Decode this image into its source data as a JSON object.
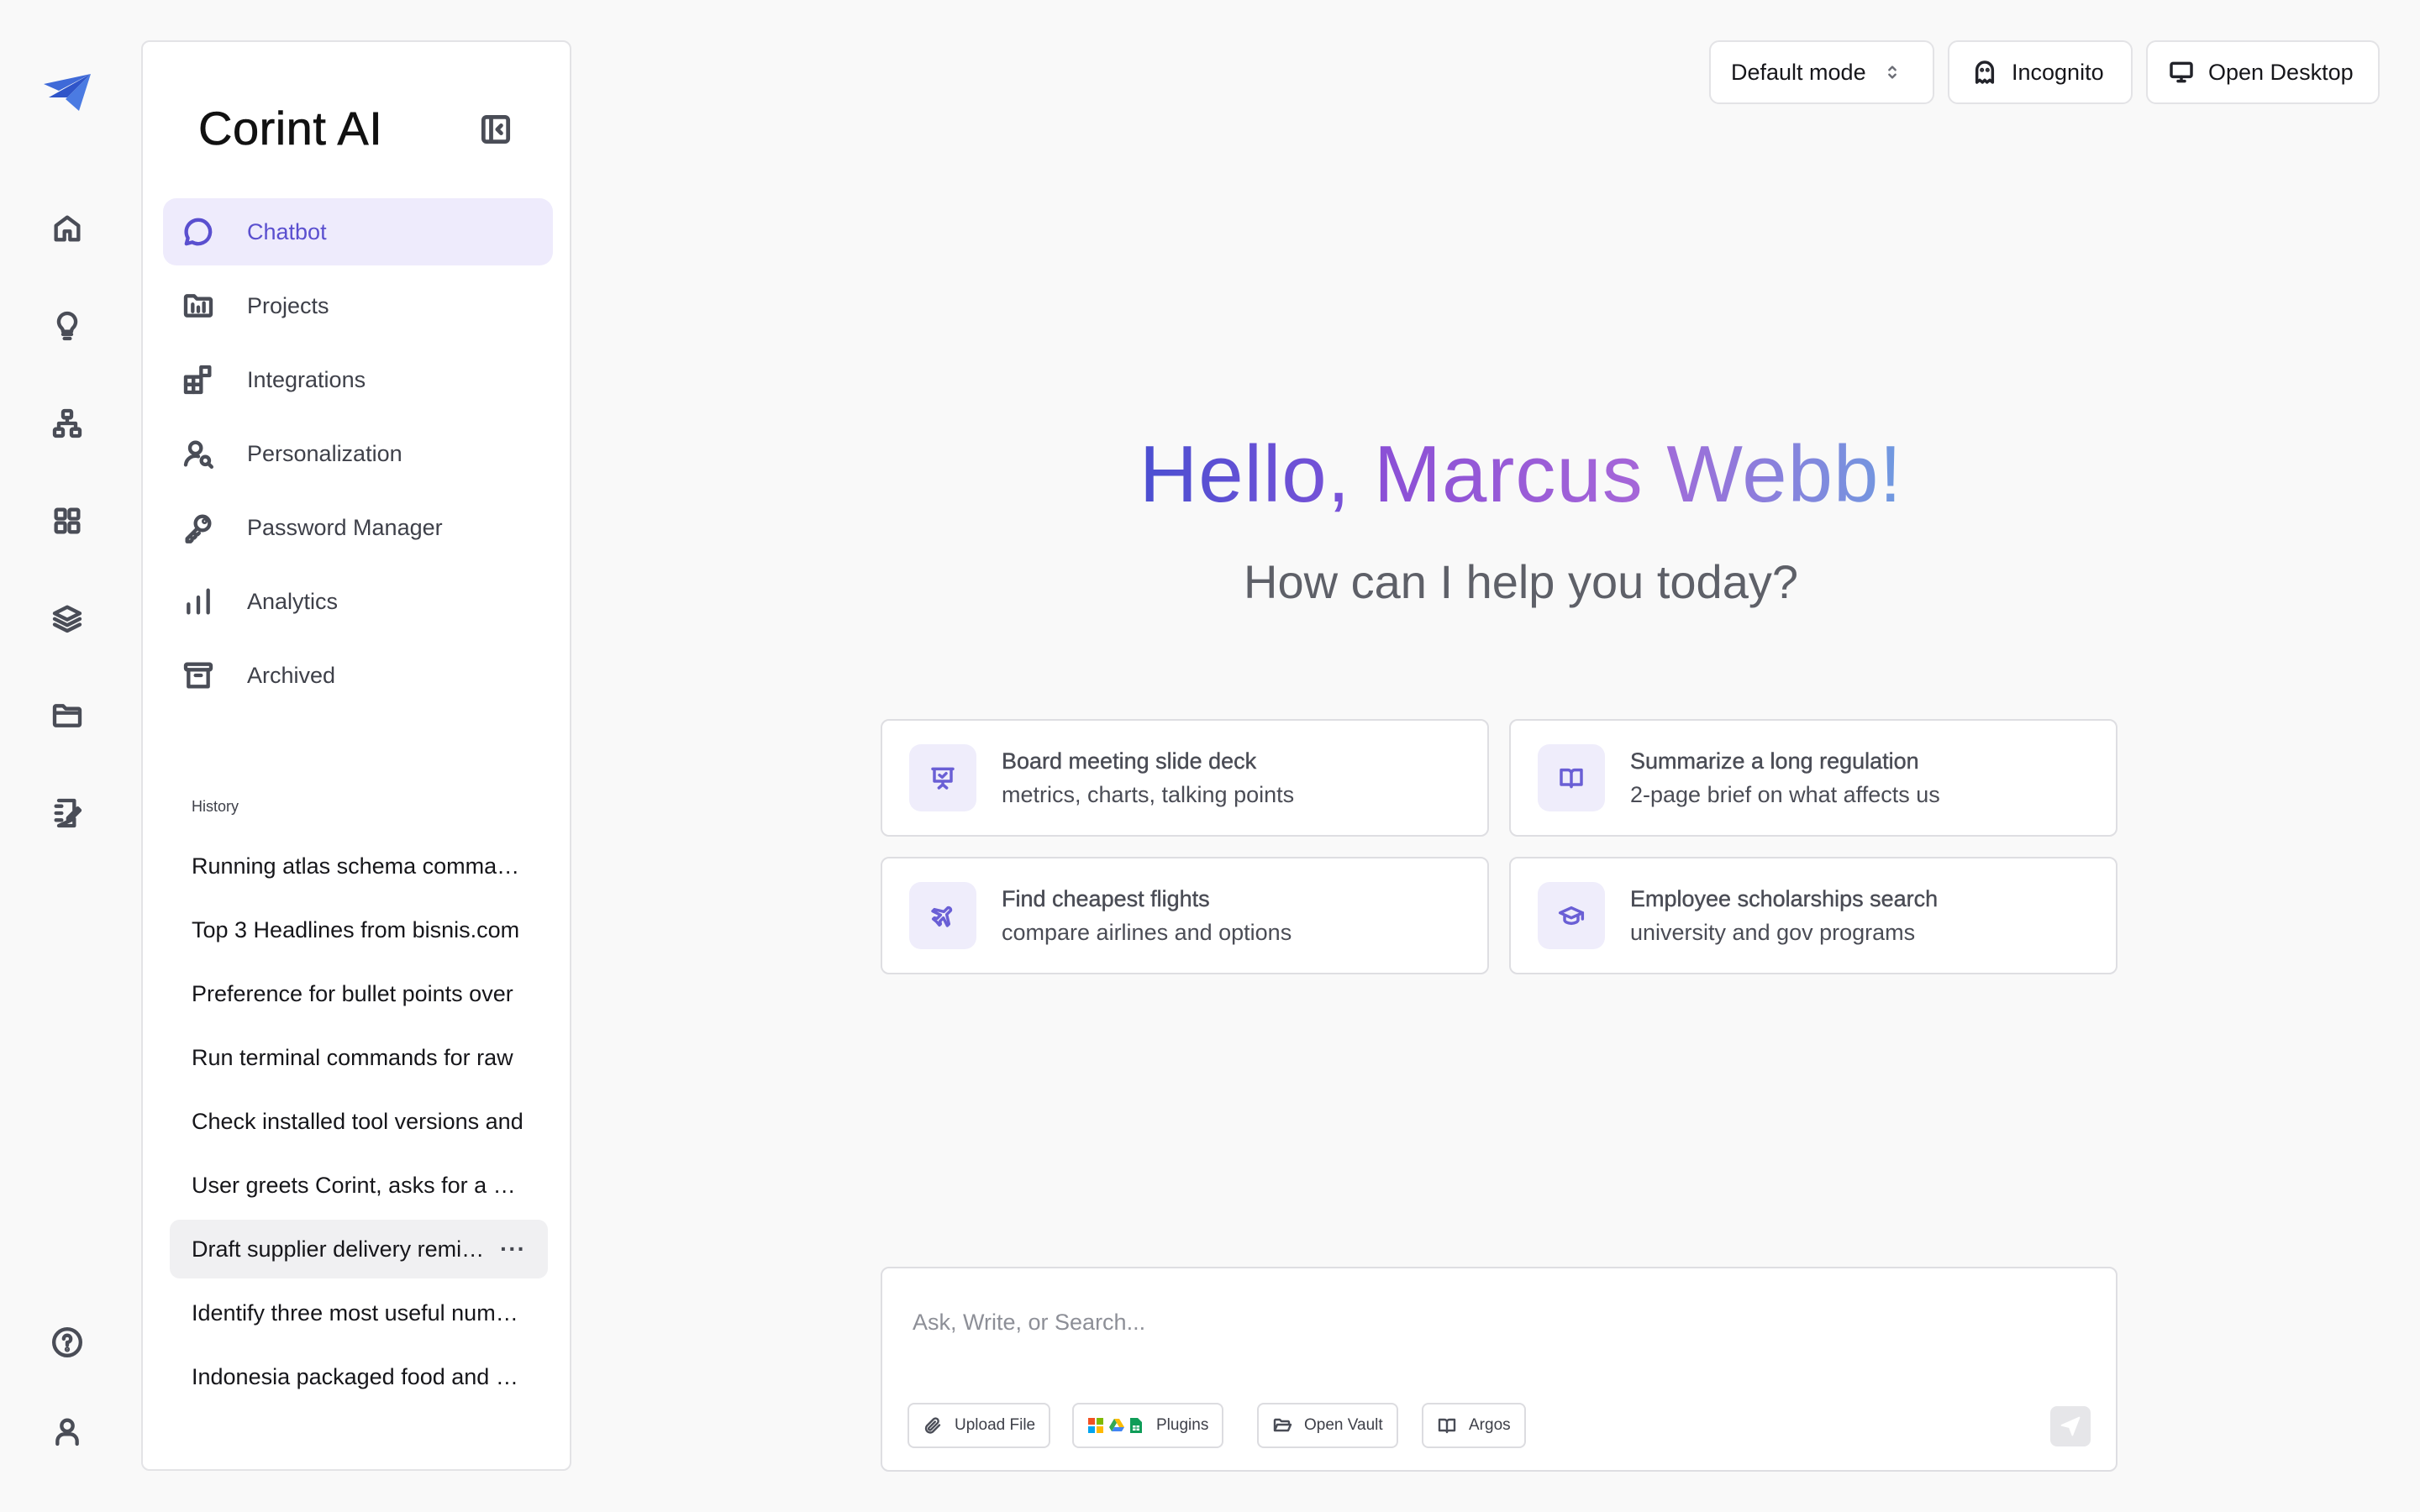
{
  "app": {
    "title": "Corint AI"
  },
  "rail": {
    "items": [
      {
        "name": "home-icon"
      },
      {
        "name": "lightbulb-icon"
      },
      {
        "name": "sitemap-icon"
      },
      {
        "name": "grid-icon"
      },
      {
        "name": "layers-icon"
      },
      {
        "name": "folder-icon"
      },
      {
        "name": "notebook-edit-icon"
      },
      {
        "name": "help-icon"
      },
      {
        "name": "user-icon"
      }
    ]
  },
  "sidebar": {
    "items": [
      {
        "label": "Chatbot",
        "icon": "chat-bubble-icon",
        "active": true
      },
      {
        "label": "Projects",
        "icon": "folder-chart-icon"
      },
      {
        "label": "Integrations",
        "icon": "integrations-icon"
      },
      {
        "label": "Personalization",
        "icon": "user-search-icon"
      },
      {
        "label": "Password Manager",
        "icon": "key-icon"
      },
      {
        "label": "Analytics",
        "icon": "bar-chart-icon"
      },
      {
        "label": "Archived",
        "icon": "archive-icon"
      }
    ],
    "history_title": "History",
    "history": [
      "Running atlas schema commands",
      "Top 3 Headlines from bisnis.com",
      "Preference for bullet points over",
      "Run terminal commands for raw",
      "Check installed tool versions and",
      "User greets Corint, asks for a help",
      "Draft supplier delivery reminder",
      "Identify three most useful numbers",
      "Indonesia packaged food and health"
    ],
    "history_active_index": 6,
    "more_label": "···"
  },
  "topbar": {
    "mode_label": "Default mode",
    "incognito_label": "Incognito",
    "open_desktop_label": "Open Desktop"
  },
  "hero": {
    "greeting_hello": "Hello,",
    "greeting_name": "Marcus Webb!",
    "subtitle": "How can I help you today?"
  },
  "suggestions": [
    {
      "title": "Board meeting slide deck",
      "subtitle": "metrics, charts, talking points",
      "icon": "presentation-icon"
    },
    {
      "title": "Summarize a long regulation",
      "subtitle": "2-page brief on what affects us",
      "icon": "book-open-icon"
    },
    {
      "title": "Find cheapest flights",
      "subtitle": "compare airlines and options",
      "icon": "plane-icon"
    },
    {
      "title": "Employee scholarships search",
      "subtitle": "university and gov programs",
      "icon": "graduation-cap-icon"
    }
  ],
  "composer": {
    "placeholder": "Ask, Write, or Search...",
    "upload_label": "Upload File",
    "plugins_label": "Plugins",
    "vault_label": "Open Vault",
    "argos_label": "Argos"
  },
  "colors": {
    "accent": "#5a4fcf",
    "active_bg": "#eeebfc",
    "hero_start": "#4b4fd1",
    "hero_end": "#6f9ae0"
  }
}
